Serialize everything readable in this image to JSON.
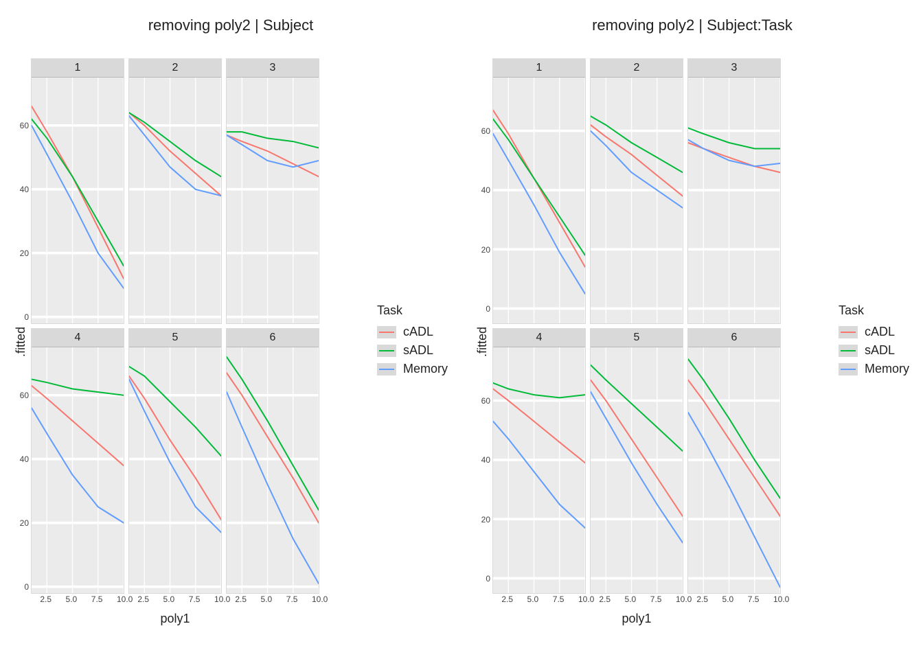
{
  "colors": {
    "cADL": "#f8766d",
    "sADL": "#00ba38",
    "Memory": "#619cff"
  },
  "legend": {
    "title": "Task",
    "items": [
      "cADL",
      "sADL",
      "Memory"
    ]
  },
  "axes": {
    "xlabel": "poly1",
    "ylabel": ".fitted",
    "xlim": [
      1,
      10
    ],
    "xticks": [
      2.5,
      5.0,
      7.5,
      10.0
    ],
    "xtick_labels": [
      "2.5",
      "5.0",
      "7.5",
      "10.0"
    ]
  },
  "x_values": [
    1,
    2.5,
    5,
    7.5,
    10
  ],
  "chart_data": [
    {
      "title": "removing poly2 | Subject",
      "ylim": [
        -2,
        75
      ],
      "yticks": [
        0,
        20,
        40,
        60
      ],
      "facets": [
        {
          "label": "1",
          "series": {
            "cADL": [
              66,
              58,
              44,
              28,
              12
            ],
            "sADL": [
              62,
              56,
              44,
              30,
              16
            ],
            "Memory": [
              60,
              51,
              36,
              20,
              9
            ]
          }
        },
        {
          "label": "2",
          "series": {
            "cADL": [
              64,
              60,
              52,
              45,
              38
            ],
            "sADL": [
              64,
              61,
              55,
              49,
              44
            ],
            "Memory": [
              63,
              57,
              47,
              40,
              38
            ]
          }
        },
        {
          "label": "3",
          "series": {
            "cADL": [
              57,
              55,
              52,
              48,
              44
            ],
            "sADL": [
              58,
              58,
              56,
              55,
              53
            ],
            "Memory": [
              57,
              54,
              49,
              47,
              49
            ]
          }
        },
        {
          "label": "4",
          "series": {
            "cADL": [
              63,
              59,
              52,
              45,
              38
            ],
            "sADL": [
              65,
              64,
              62,
              61,
              60
            ],
            "Memory": [
              56,
              48,
              35,
              25,
              20
            ]
          }
        },
        {
          "label": "5",
          "series": {
            "cADL": [
              66,
              59,
              46,
              34,
              21
            ],
            "sADL": [
              69,
              66,
              58,
              50,
              41
            ],
            "Memory": [
              65,
              55,
              39,
              25,
              17
            ]
          }
        },
        {
          "label": "6",
          "series": {
            "cADL": [
              67,
              60,
              47,
              34,
              20
            ],
            "sADL": [
              72,
              65,
              52,
              38,
              24
            ],
            "Memory": [
              61,
              50,
              32,
              15,
              1
            ]
          }
        }
      ]
    },
    {
      "title": "removing poly2 | Subject:Task",
      "ylim": [
        -5,
        78
      ],
      "yticks": [
        0,
        20,
        40,
        60
      ],
      "facets": [
        {
          "label": "1",
          "series": {
            "cADL": [
              67,
              59,
              44,
              29,
              14
            ],
            "sADL": [
              64,
              57,
              44,
              31,
              18
            ],
            "Memory": [
              59,
              50,
              35,
              19,
              5
            ]
          }
        },
        {
          "label": "2",
          "series": {
            "cADL": [
              62,
              58,
              52,
              45,
              38
            ],
            "sADL": [
              65,
              62,
              56,
              51,
              46
            ],
            "Memory": [
              60,
              55,
              46,
              40,
              34
            ]
          }
        },
        {
          "label": "3",
          "series": {
            "cADL": [
              56,
              54,
              51,
              48,
              46
            ],
            "sADL": [
              61,
              59,
              56,
              54,
              54
            ],
            "Memory": [
              57,
              54,
              50,
              48,
              49
            ]
          }
        },
        {
          "label": "4",
          "series": {
            "cADL": [
              64,
              60,
              53,
              46,
              39
            ],
            "sADL": [
              66,
              64,
              62,
              61,
              62
            ],
            "Memory": [
              53,
              47,
              36,
              25,
              17
            ]
          }
        },
        {
          "label": "5",
          "series": {
            "cADL": [
              67,
              60,
              47,
              34,
              21
            ],
            "sADL": [
              72,
              67,
              59,
              51,
              43
            ],
            "Memory": [
              63,
              54,
              39,
              25,
              12
            ]
          }
        },
        {
          "label": "6",
          "series": {
            "cADL": [
              67,
              60,
              47,
              34,
              21
            ],
            "sADL": [
              74,
              67,
              54,
              40,
              27
            ],
            "Memory": [
              56,
              47,
              31,
              14,
              -3
            ]
          }
        }
      ]
    }
  ]
}
